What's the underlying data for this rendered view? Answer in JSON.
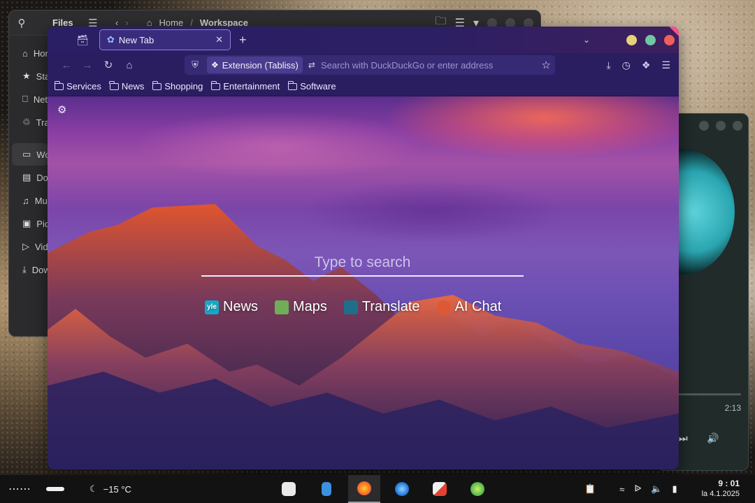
{
  "files_window": {
    "title": "Files",
    "breadcrumb": [
      "Home",
      "Workspace"
    ],
    "sidebar": [
      {
        "label": "Home",
        "icon": "home-icon"
      },
      {
        "label": "Starred",
        "icon": "star-icon"
      },
      {
        "label": "Network",
        "icon": "network-icon"
      },
      {
        "label": "Trash",
        "icon": "trash-icon"
      },
      {
        "label": "Workspace",
        "icon": "folder-icon",
        "active": true
      },
      {
        "label": "Documents",
        "icon": "document-icon"
      },
      {
        "label": "Music",
        "icon": "music-icon"
      },
      {
        "label": "Pictures",
        "icon": "picture-icon"
      },
      {
        "label": "Videos",
        "icon": "video-icon"
      },
      {
        "label": "Downloads",
        "icon": "download-icon"
      }
    ]
  },
  "music_window": {
    "time": "2:13"
  },
  "browser": {
    "tab_title": "New Tab",
    "extension_label": "Extension (Tabliss)",
    "url_placeholder": "Search with DuckDuckGo or enter address",
    "bookmarks": [
      "Services",
      "News",
      "Shopping",
      "Entertainment",
      "Software"
    ],
    "traffic_lights": [
      "#e6d27a",
      "#6fc7a3",
      "#f0605a"
    ],
    "accent": "#3a2c7c"
  },
  "newtab": {
    "search_placeholder": "Type to search",
    "quick_links": [
      {
        "label": "News",
        "icon": "yle-icon",
        "icon_text": "yle",
        "color": "#17a9c9"
      },
      {
        "label": "Maps",
        "icon": "maps-icon",
        "icon_text": "",
        "color": "#6fae56"
      },
      {
        "label": "Translate",
        "icon": "translate-icon",
        "icon_text": "",
        "color": "#1f6f8b"
      },
      {
        "label": "AI Chat",
        "icon": "duckduckgo-icon",
        "icon_text": "",
        "color": "#de5833"
      }
    ]
  },
  "taskbar": {
    "weather": "−15 °C",
    "time": "9 : 01",
    "date": "la 4.1.2025"
  }
}
